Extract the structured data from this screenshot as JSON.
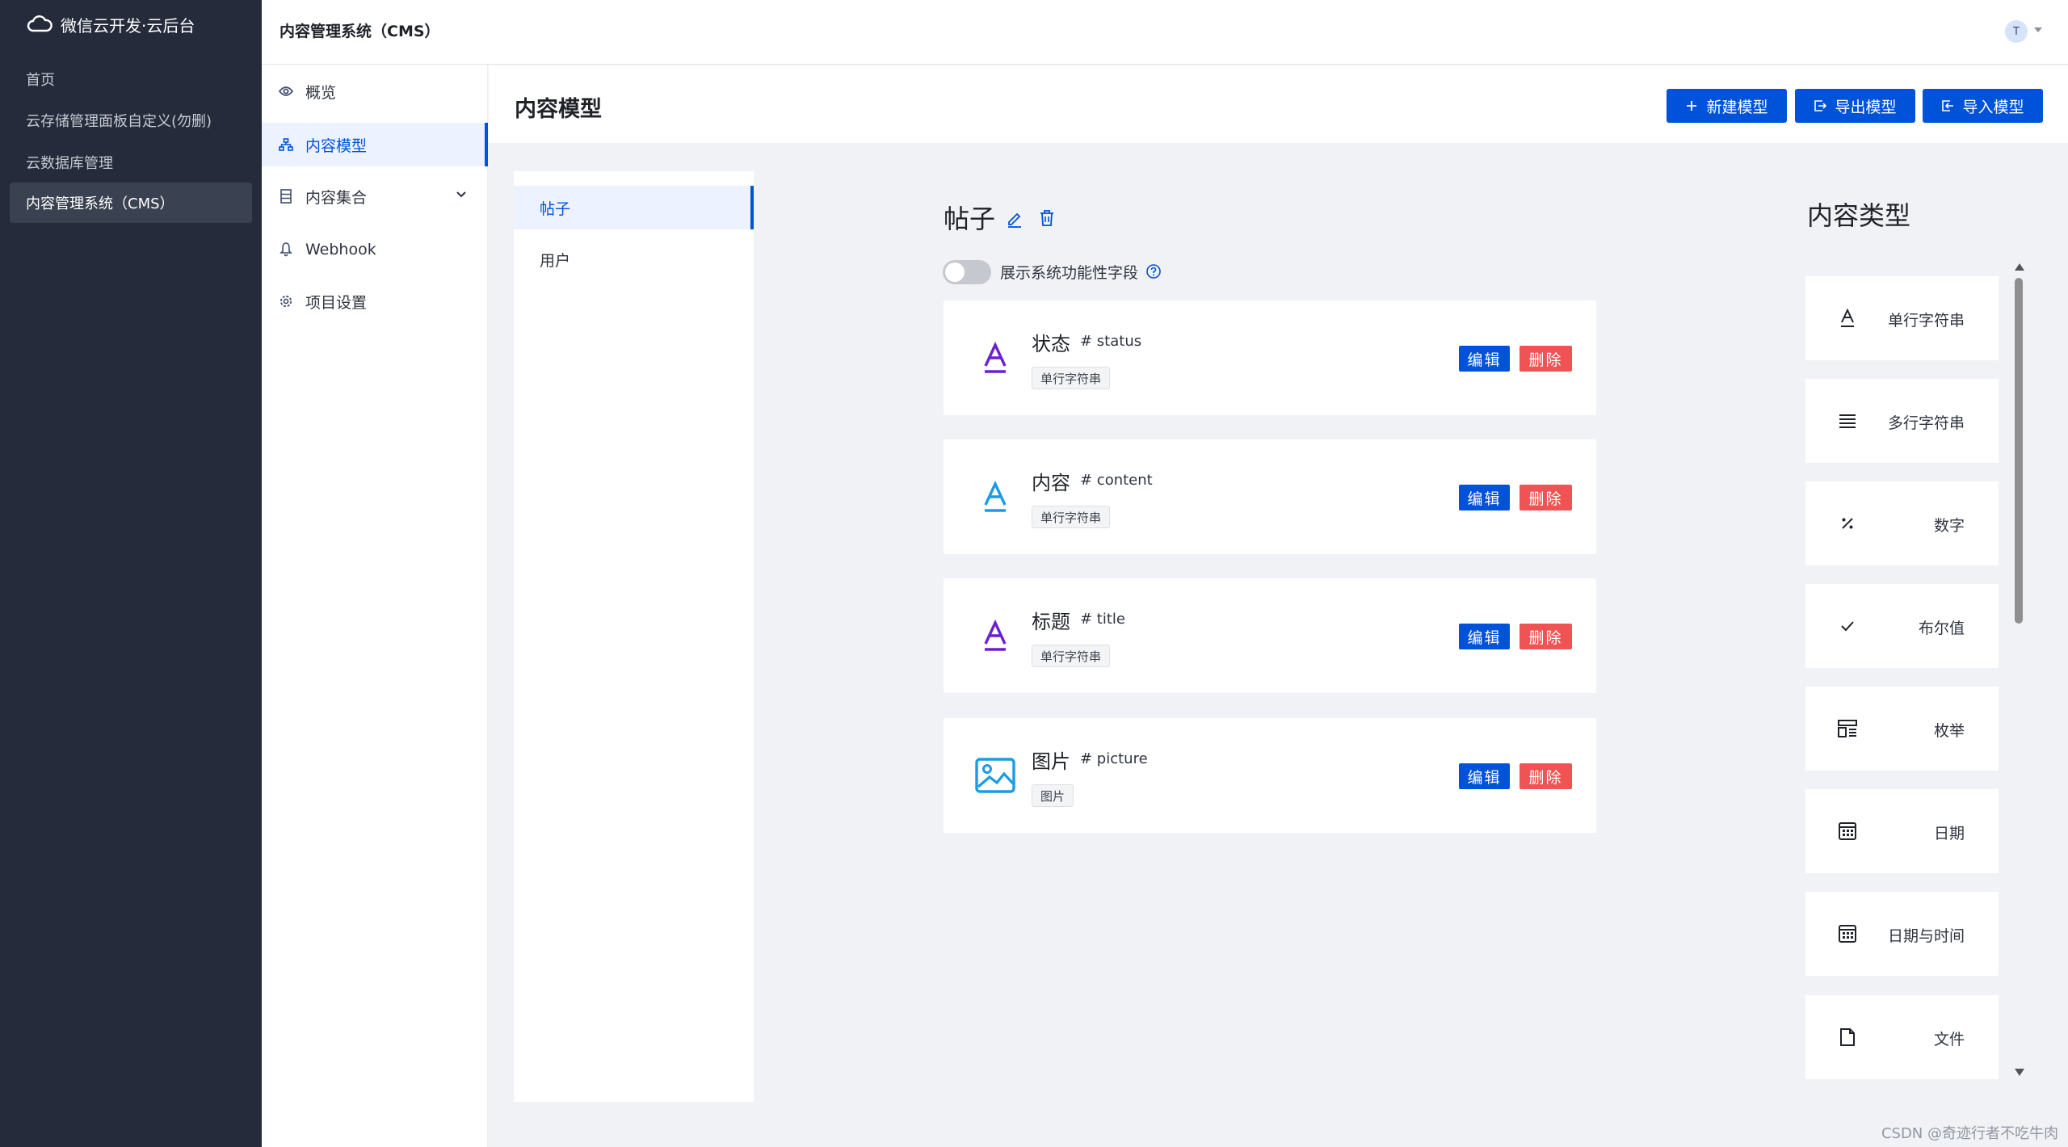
{
  "brand": {
    "name": "微信云开发·云后台"
  },
  "dark_sidebar": {
    "items": [
      {
        "label": "首页"
      },
      {
        "label": "云存储管理面板自定义(勿删)"
      },
      {
        "label": "云数据库管理"
      },
      {
        "label": "内容管理系统（CMS）"
      }
    ]
  },
  "header": {
    "title": "内容管理系统（CMS）",
    "avatar_initial": "T"
  },
  "sub_nav": {
    "items": [
      {
        "label": "概览",
        "icon": "eye-icon"
      },
      {
        "label": "内容模型",
        "icon": "model-tree-icon"
      },
      {
        "label": "内容集合",
        "icon": "collection-icon"
      },
      {
        "label": "Webhook",
        "icon": "webhook-icon"
      },
      {
        "label": "项目设置",
        "icon": "gear-icon"
      }
    ]
  },
  "page": {
    "title": "内容模型",
    "buttons": {
      "new_model": "新建模型",
      "export_model": "导出模型",
      "import_model": "导入模型"
    }
  },
  "models": [
    {
      "label": "帖子"
    },
    {
      "label": "用户"
    }
  ],
  "model_detail": {
    "name": "帖子",
    "toggle_label": "展示系统功能性字段",
    "toggle_on": false,
    "fields": [
      {
        "name": "状态",
        "key": "# status",
        "type": "单行字符串",
        "icon": "text-icon",
        "icon_color": "#6b1fd1"
      },
      {
        "name": "内容",
        "key": "# content",
        "type": "单行字符串",
        "icon": "text-icon",
        "icon_color": "#1a9be6"
      },
      {
        "name": "标题",
        "key": "# title",
        "type": "单行字符串",
        "icon": "text-icon",
        "icon_color": "#6b1fd1"
      },
      {
        "name": "图片",
        "key": "# picture",
        "type": "图片",
        "icon": "image-icon",
        "icon_color": "#1a9be6"
      }
    ],
    "edit_label": "编辑",
    "delete_label": "删除"
  },
  "content_types": {
    "title": "内容类型",
    "items": [
      {
        "label": "单行字符串",
        "icon": "text-icon"
      },
      {
        "label": "多行字符串",
        "icon": "multiline-icon"
      },
      {
        "label": "数字",
        "icon": "percent-icon"
      },
      {
        "label": "布尔值",
        "icon": "check-icon"
      },
      {
        "label": "枚举",
        "icon": "enum-icon"
      },
      {
        "label": "日期",
        "icon": "calendar-icon"
      },
      {
        "label": "日期与时间",
        "icon": "calendar-icon"
      },
      {
        "label": "文件",
        "icon": "file-icon"
      }
    ]
  },
  "watermark": "CSDN @奇迹行者不吃牛肉",
  "colors": {
    "primary": "#0052d9",
    "danger": "#f05353",
    "sidebar_bg": "#252b3a"
  }
}
